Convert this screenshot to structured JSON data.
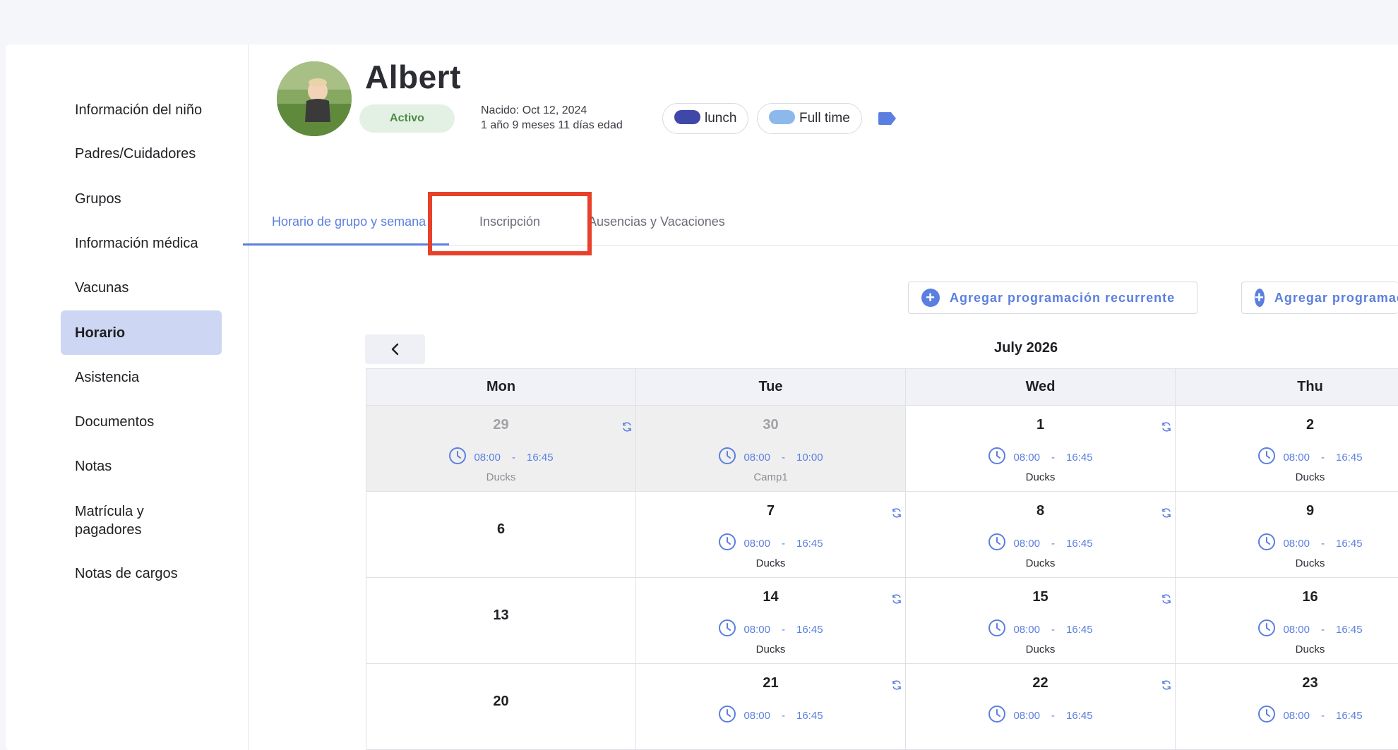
{
  "sidebar": {
    "items": [
      {
        "label": "Información del niño"
      },
      {
        "label": "Padres/Cuidadores"
      },
      {
        "label": "Grupos"
      },
      {
        "label": "Información médica"
      },
      {
        "label": "Vacunas"
      },
      {
        "label": "Horario"
      },
      {
        "label": "Asistencia"
      },
      {
        "label": "Documentos"
      },
      {
        "label": "Notas"
      },
      {
        "label": "Matrícula y pagadores"
      },
      {
        "label": "Notas de cargos"
      }
    ]
  },
  "child": {
    "name": "Albert",
    "status": "Activo",
    "born": "Nacido: Oct 12, 2024",
    "age": "1 año 9 meses 11 días edad",
    "tags": [
      {
        "label": "lunch",
        "color": "#3f48a8"
      },
      {
        "label": "Full time",
        "color": "#8db8ec"
      }
    ],
    "tag_icon_color": "#5b7fe0"
  },
  "tabs": [
    {
      "label": "Horario de grupo y semana"
    },
    {
      "label": "Inscripción"
    },
    {
      "label": "Ausencias y Vacaciones"
    }
  ],
  "actions": {
    "recurring": "Agregar programación recurrente",
    "single": "Agregar programación"
  },
  "calendar": {
    "month": "July 2026",
    "headers": [
      "Mon",
      "Tue",
      "Wed",
      "Thu"
    ],
    "weeks": [
      [
        {
          "day": "29",
          "start": "08:00",
          "end": "16:45",
          "group": "Ducks",
          "past": true,
          "recurring": true
        },
        {
          "day": "30",
          "start": "08:00",
          "end": "10:00",
          "group": "Camp1",
          "past": true,
          "recurring": false
        },
        {
          "day": "1",
          "start": "08:00",
          "end": "16:45",
          "group": "Ducks",
          "past": false,
          "recurring": true
        },
        {
          "day": "2",
          "start": "08:00",
          "end": "16:45",
          "group": "Ducks",
          "past": false,
          "recurring": false
        }
      ],
      [
        {
          "day": "6"
        },
        {
          "day": "7",
          "start": "08:00",
          "end": "16:45",
          "group": "Ducks",
          "recurring": true
        },
        {
          "day": "8",
          "start": "08:00",
          "end": "16:45",
          "group": "Ducks",
          "recurring": true
        },
        {
          "day": "9",
          "start": "08:00",
          "end": "16:45",
          "group": "Ducks",
          "recurring": false
        }
      ],
      [
        {
          "day": "13"
        },
        {
          "day": "14",
          "start": "08:00",
          "end": "16:45",
          "group": "Ducks",
          "recurring": true
        },
        {
          "day": "15",
          "start": "08:00",
          "end": "16:45",
          "group": "Ducks",
          "recurring": true
        },
        {
          "day": "16",
          "start": "08:00",
          "end": "16:45",
          "group": "Ducks",
          "recurring": false
        }
      ],
      [
        {
          "day": "20"
        },
        {
          "day": "21",
          "start": "08:00",
          "end": "16:45",
          "recurring": true
        },
        {
          "day": "22",
          "start": "08:00",
          "end": "16:45",
          "recurring": true
        },
        {
          "day": "23",
          "start": "08:00",
          "end": "16:45",
          "recurring": false
        }
      ]
    ]
  },
  "colors": {
    "accent": "#5b7fe0",
    "highlight": "#e8412b"
  }
}
